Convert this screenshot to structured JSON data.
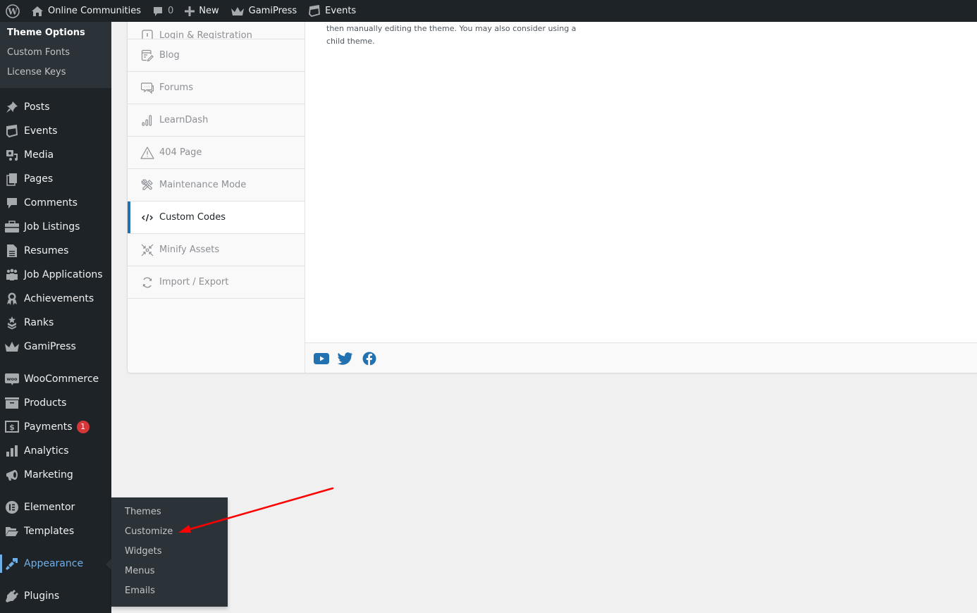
{
  "adminbar": {
    "site_name": "Online Communities",
    "comments_count": "0",
    "new_label": "New",
    "gamipress_label": "GamiPress",
    "events_label": "Events"
  },
  "sidebar": {
    "submenu": [
      {
        "label": "Theme Options",
        "current": true
      },
      {
        "label": "Custom Fonts"
      },
      {
        "label": "License Keys"
      }
    ],
    "items": [
      {
        "label": "Posts",
        "icon": "pin-icon"
      },
      {
        "label": "Events",
        "icon": "calendar-icon"
      },
      {
        "label": "Media",
        "icon": "media-icon"
      },
      {
        "label": "Pages",
        "icon": "pages-icon"
      },
      {
        "label": "Comments",
        "icon": "comment-icon"
      },
      {
        "label": "Job Listings",
        "icon": "briefcase-icon"
      },
      {
        "label": "Resumes",
        "icon": "document-icon"
      },
      {
        "label": "Job Applications",
        "icon": "groups-icon"
      },
      {
        "label": "Achievements",
        "icon": "award-icon"
      },
      {
        "label": "Ranks",
        "icon": "rank-icon"
      },
      {
        "label": "GamiPress",
        "icon": "crown-icon"
      },
      {
        "label": "WooCommerce",
        "icon": "woo-icon"
      },
      {
        "label": "Products",
        "icon": "archive-icon"
      },
      {
        "label": "Payments",
        "icon": "dollar-icon",
        "badge": "1"
      },
      {
        "label": "Analytics",
        "icon": "bar-chart-icon"
      },
      {
        "label": "Marketing",
        "icon": "megaphone-icon"
      },
      {
        "label": "Elementor",
        "icon": "elementor-icon"
      },
      {
        "label": "Templates",
        "icon": "folder-icon"
      },
      {
        "label": "Appearance",
        "icon": "paintbrush-icon",
        "active": true
      },
      {
        "label": "Plugins",
        "icon": "plug-icon"
      }
    ],
    "flyout": [
      "Themes",
      "Customize",
      "Widgets",
      "Menus",
      "Emails"
    ]
  },
  "panel": {
    "tabs": [
      {
        "label": "Login & Registration",
        "icon": "login-icon"
      },
      {
        "label": "Blog",
        "icon": "blog-icon"
      },
      {
        "label": "Forums",
        "icon": "forum-icon"
      },
      {
        "label": "LearnDash",
        "icon": "signal-icon"
      },
      {
        "label": "404 Page",
        "icon": "warning-icon"
      },
      {
        "label": "Maintenance Mode",
        "icon": "tools-icon"
      },
      {
        "label": "Custom Codes",
        "icon": "code-icon",
        "active": true
      },
      {
        "label": "Minify Assets",
        "icon": "compress-icon"
      },
      {
        "label": "Import / Export",
        "icon": "sync-icon"
      }
    ],
    "content_text": "then manually editing the theme. You may also consider using a child theme.",
    "social": [
      "youtube-icon",
      "twitter-icon",
      "facebook-icon"
    ]
  },
  "colors": {
    "accent": "#2271b1",
    "active_menu": "#72aee6",
    "badge": "#d63638",
    "annotation_arrow": "#ff0000"
  }
}
